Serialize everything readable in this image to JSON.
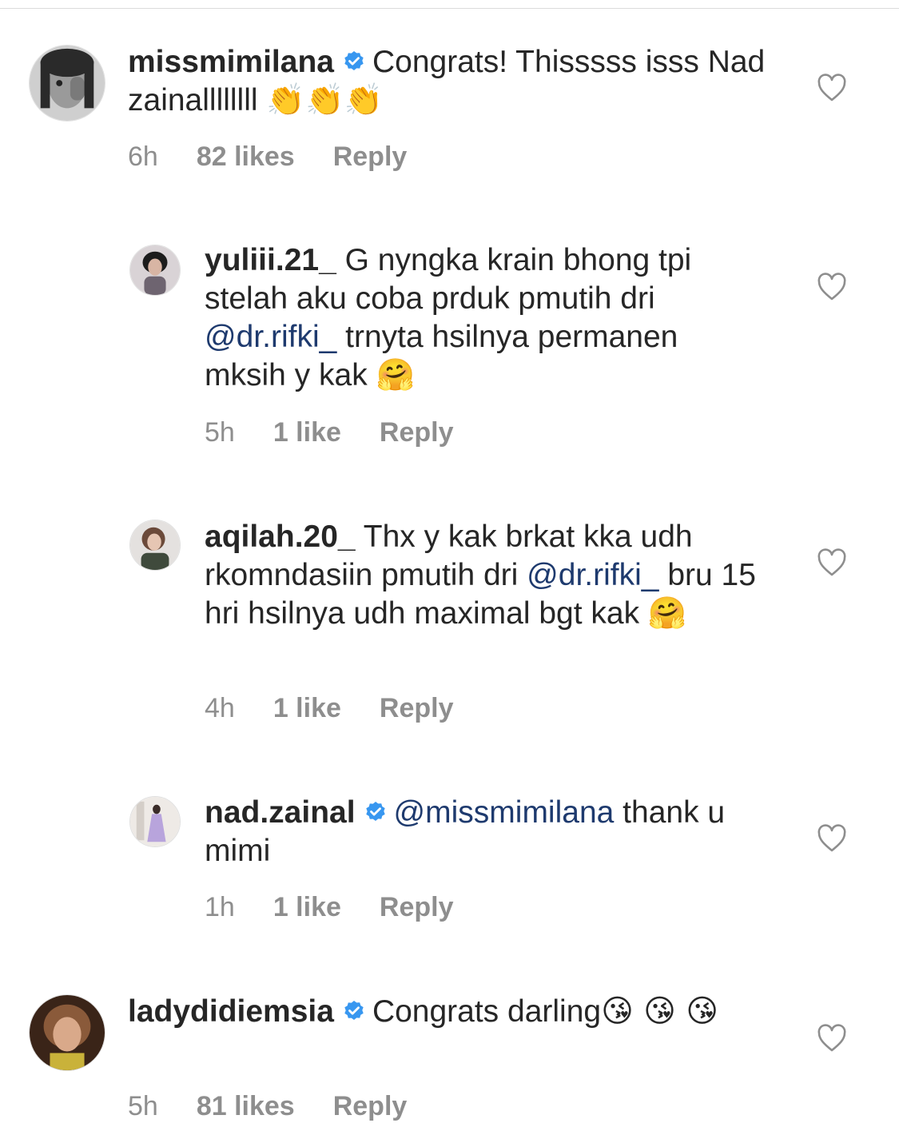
{
  "comments": [
    {
      "username": "missmimilana",
      "verified": true,
      "text": "Congrats! Thisssss isss Nad zainallllllll",
      "emojis": "👏👏👏",
      "time": "6h",
      "likes": "82 likes",
      "reply_label": "Reply"
    },
    {
      "username": "yuliii.21_",
      "verified": false,
      "text_before": "G nyngka krain bhong tpi stelah aku coba prduk pmutih dri",
      "mention": "@dr.rifki_",
      "text_after": "trnyta hsilnya permanen mksih y kak",
      "emojis": "🤗",
      "time": "5h",
      "likes": "1 like",
      "reply_label": "Reply"
    },
    {
      "username": "aqilah.20_",
      "verified": false,
      "text_before": "Thx y kak brkat kka udh rkomndasiin pmutih dri",
      "mention": "@dr.rifki_",
      "text_after": "bru 15 hri hsilnya udh maximal bgt kak",
      "emojis": "🤗",
      "time": "4h",
      "likes": "1 like",
      "reply_label": "Reply"
    },
    {
      "username": "nad.zainal",
      "verified": true,
      "mention": "@missmimilana",
      "text_after": "thank u mimi",
      "time": "1h",
      "likes": "1 like",
      "reply_label": "Reply"
    },
    {
      "username": "ladydidiemsia",
      "verified": true,
      "text": "Congrats darling",
      "emojis": "😘 😘 😘",
      "time": "5h",
      "likes": "81 likes",
      "reply_label": "Reply"
    }
  ],
  "colors": {
    "text": "#262626",
    "meta": "#8e8e8e",
    "mention": "#1e3a6e",
    "verified": "#3897f0"
  }
}
